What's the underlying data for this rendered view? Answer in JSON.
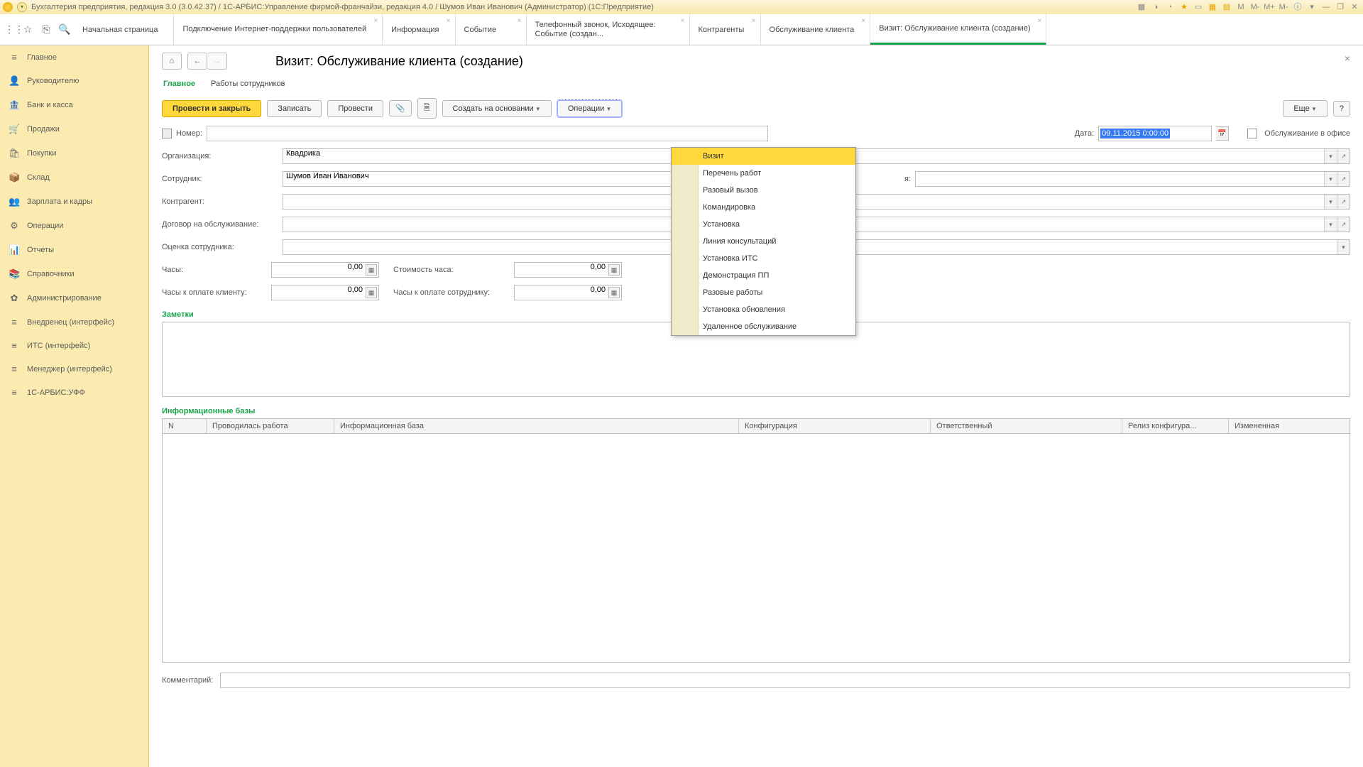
{
  "titlebar": {
    "title": "Бухгалтерия предприятия, редакция 3.0 (3.0.42.37) / 1С-АРБИС:Управление фирмой-франчайзи, редакция 4.0 / Шумов Иван Иванович (Администратор)  (1С:Предприятие)",
    "tr": [
      "M",
      "M-",
      "M+",
      "M-"
    ]
  },
  "tabs": [
    {
      "label": "Начальная страница",
      "closable": false
    },
    {
      "label": "Подключение Интернет-поддержки пользователей",
      "closable": true,
      "two": true
    },
    {
      "label": "Информация",
      "closable": true
    },
    {
      "label": "Событие",
      "closable": true
    },
    {
      "label": "Телефонный звонок, Исходящее: Событие (создан...",
      "closable": true,
      "two": true
    },
    {
      "label": "Контрагенты",
      "closable": true
    },
    {
      "label": "Обслуживание клиента",
      "closable": true
    },
    {
      "label": "Визит: Обслуживание клиента (создание)",
      "closable": true,
      "active": true
    }
  ],
  "sidebar": [
    {
      "icon": "≡",
      "label": "Главное"
    },
    {
      "icon": "👤",
      "label": "Руководителю"
    },
    {
      "icon": "🏦",
      "label": "Банк и касса"
    },
    {
      "icon": "🛒",
      "label": "Продажи"
    },
    {
      "icon": "🛍",
      "label": "Покупки"
    },
    {
      "icon": "📦",
      "label": "Склад"
    },
    {
      "icon": "👥",
      "label": "Зарплата и кадры"
    },
    {
      "icon": "⚙",
      "label": "Операции"
    },
    {
      "icon": "📊",
      "label": "Отчеты"
    },
    {
      "icon": "📚",
      "label": "Справочники"
    },
    {
      "icon": "✿",
      "label": "Администрирование"
    },
    {
      "icon": "≡",
      "label": "Внедренец (интерфейс)"
    },
    {
      "icon": "≡",
      "label": "ИТС (интерфейс)"
    },
    {
      "icon": "≡",
      "label": "Менеджер (интерфейс)"
    },
    {
      "icon": "≡",
      "label": "1С-АРБИС:УФФ"
    }
  ],
  "page": {
    "title": "Визит: Обслуживание клиента (создание)",
    "phtabs": {
      "main": "Главное",
      "works": "Работы сотрудников"
    },
    "buttons": {
      "post_close": "Провести и закрыть",
      "write": "Записать",
      "post": "Провести",
      "create_based": "Создать на основании",
      "operations": "Операции",
      "more": "Еще",
      "help": "?"
    },
    "labels": {
      "number": "Номер:",
      "date": "Дата:",
      "office": "Обслуживание в офисе",
      "org": "Организация:",
      "employee": "Сотрудник:",
      "counterparty": "Контрагент:",
      "contract": "Договор на обслуживание:",
      "rating": "Оценка сотрудника:",
      "hours": "Часы:",
      "hourcost": "Стоимость часа:",
      "hours_client": "Часы к оплате клиенту:",
      "hours_emp": "Часы к оплате сотруднику:",
      "extra": "я:",
      "notes": "Заметки",
      "infobases": "Информационные базы",
      "comment": "Комментарий:"
    },
    "values": {
      "date": "09.11.2015  0:00:00",
      "org": "Квадрика",
      "employee": "Шумов Иван Иванович",
      "hours": "0,00",
      "hourcost": "0,00",
      "hours_client": "0,00",
      "hours_emp": "0,00"
    },
    "tableheaders": {
      "n": "N",
      "work": "Проводилась работа",
      "ib": "Информационная база",
      "conf": "Конфигурация",
      "resp": "Ответственный",
      "release": "Релиз конфигура...",
      "changed": "Измененная"
    }
  },
  "menu": [
    "Визит",
    "Перечень работ",
    "Разовый вызов",
    "Командировка",
    "Установка",
    "Линия консультаций",
    "Установка ИТС",
    "Демонстрация ПП",
    "Разовые работы",
    "Установка обновления",
    "Удаленное обслуживание"
  ]
}
